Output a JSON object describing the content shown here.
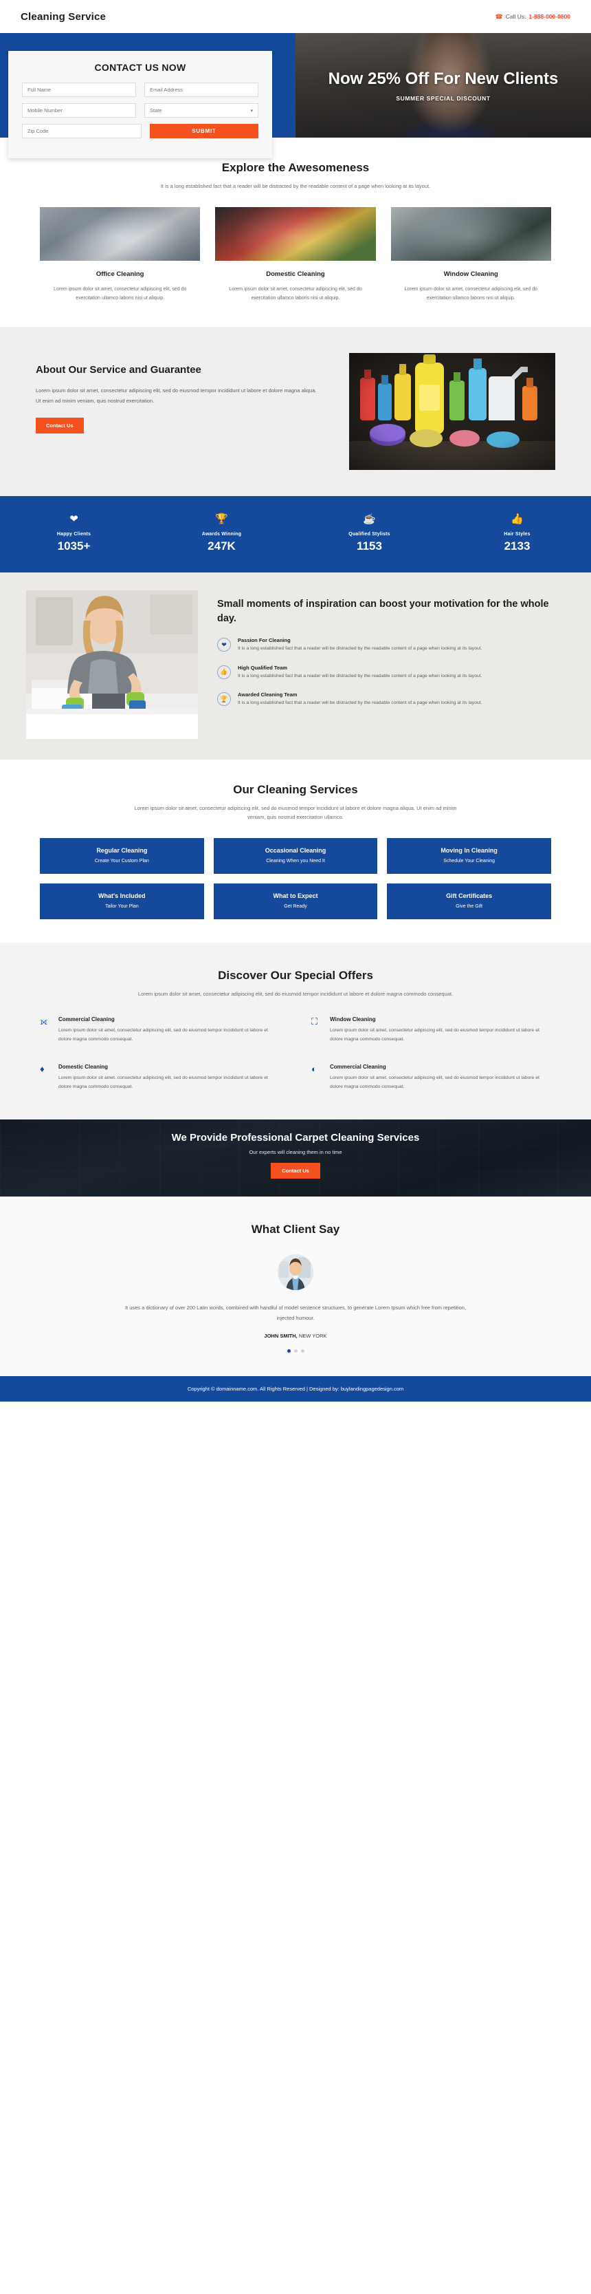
{
  "header": {
    "brand": "Cleaning Service",
    "call_label": "Call Us:",
    "phone": "1-888-000-0800",
    "phone_icon": "phone-icon"
  },
  "hero": {
    "headline": "Now 25% Off For New Clients",
    "subline": "SUMMER SPECIAL DISCOUNT"
  },
  "contact_form": {
    "title": "CONTACT US NOW",
    "full_name_placeholder": "Full Name",
    "email_placeholder": "Email Address",
    "mobile_placeholder": "Mobile Number",
    "state_placeholder": "State",
    "zip_placeholder": "Zip Code",
    "submit_label": "SUBMIT"
  },
  "explore": {
    "title": "Explore the Awesomeness",
    "desc": "It is a long established fact that a reader will be distracted by the readable content of a page when looking at its layout.",
    "cards": [
      {
        "title": "Office Cleaning",
        "text": "Lorem ipsum dolor sit amet, consectetur adipiscing elit, sed do exercitation ullamco laboris nisi ut aliquip."
      },
      {
        "title": "Domestic Cleaning",
        "text": "Lorem ipsum dolor sit amet, consectetur adipiscing elit, sed do exercitation ullamco laboris nisi ut aliquip."
      },
      {
        "title": "Window Cleaning",
        "text": "Lorem ipsum dolor sit amet, consectetur adipiscing elit, sed do exercitation ullamco laboris nisi ut aliquip."
      }
    ]
  },
  "about": {
    "title": "About Our Service and Guarantee",
    "text": "Lorem ipsum dolor sit amet, consectetur adipiscing elit, sed do eiusmod tempor incididunt ut labore et dolore magna aliqua. Ut enim ad minim veniam, quis nostrud exercitation.",
    "button": "Contact Us"
  },
  "stats": [
    {
      "icon": "heart-icon",
      "label": "Happy Clients",
      "value": "1035+"
    },
    {
      "icon": "trophy-icon",
      "label": "Awards Winning",
      "value": "247K"
    },
    {
      "icon": "coffee-cup-icon",
      "label": "Qualified Stylists",
      "value": "1153"
    },
    {
      "icon": "thumbs-up-icon",
      "label": "Hair Styles",
      "value": "2133"
    }
  ],
  "inspiration": {
    "title": "Small moments of inspiration can boost your motivation for the whole day.",
    "features": [
      {
        "icon": "heart-icon",
        "title": "Passion For Cleaning",
        "text": "It is a long established fact that a reader will be distracted by the readable content of a page when looking at its layout."
      },
      {
        "icon": "thumbs-up-icon",
        "title": "High Qualified Team",
        "text": "It is a long established fact that a reader will be distracted by the readable content of a page when looking at its layout."
      },
      {
        "icon": "trophy-icon",
        "title": "Awarded Cleaning Team",
        "text": "It is a long established fact that a reader will be distracted by the readable content of a page when looking at its layout."
      }
    ]
  },
  "services": {
    "title": "Our Cleaning Services",
    "desc": "Lorem ipsum dolor sit amet, consectetur adipiscing elit, sed do eiusmod tempor incididunt ut labore et dolore magna aliqua. Ut enim ad minim veniam, quis nostrud exercitation ullamco.",
    "tiles": [
      {
        "title": "Regular Cleaning",
        "sub": "Create Your Custom Plan"
      },
      {
        "title": "Occasional Cleaning",
        "sub": "Cleaning When you Need It"
      },
      {
        "title": "Moving In Cleaning",
        "sub": "Schedule Your Cleaning"
      },
      {
        "title": "What's Included",
        "sub": "Tailor Your Plan"
      },
      {
        "title": "What to Expect",
        "sub": "Get Ready"
      },
      {
        "title": "Gift Certificates",
        "sub": "Give the Gift"
      }
    ]
  },
  "offers": {
    "title": "Discover Our Special Offers",
    "desc": "Lorem ipsum dolor sit amet, consectetur adipiscing elit, sed do eiusmod tempor incididunt ut labore et dolore magna commodo consequat.",
    "items": [
      {
        "icon": "shuffle-icon",
        "title": "Commercial Cleaning",
        "text": "Lorem ipsum dolor sit amet, consectetur adipiscing elit, sed do eiusmod tempor incididunt ut labore et dolore magna commodo consequat."
      },
      {
        "icon": "window-icon",
        "title": "Window Cleaning",
        "text": "Lorem ipsum dolor sit amet, consectetur adipiscing elit, sed do eiusmod tempor incididunt ut labore et dolore magna commodo consequat."
      },
      {
        "icon": "diamond-icon",
        "title": "Domestic Cleaning",
        "text": "Lorem ipsum dolor sit amet, consectetur adipiscing elit, sed do eiusmod tempor incididunt ut labore et dolore magna commodo consequat."
      },
      {
        "icon": "pie-chart-icon",
        "title": "Commercial Cleaning",
        "text": "Lorem ipsum dolor sit amet, consectetur adipiscing elit, sed do eiusmod tempor incididunt ut labore et dolore magna commodo consequat."
      }
    ]
  },
  "cta": {
    "title": "We Provide Professional Carpet Cleaning Services",
    "sub": "Our experts will cleaning them in no time",
    "button": "Contact Us"
  },
  "testimonial": {
    "title": "What Client Say",
    "quote": "It uses a dictionary of over 200 Latin words, combined with handful of model sentence structures, to generate Lorem Ipsum which free from repetition, injected humour.",
    "author": "JOHN SMITH,",
    "location": "NEW YORK",
    "dots": [
      true,
      false,
      false
    ]
  },
  "footer": {
    "text": "Copyright © domainname.com. All Rights Reserved | Designed by: buylandingpagedesign.com"
  },
  "colors": {
    "brand_blue": "#14499c",
    "accent_orange": "#f4511e",
    "phone_red": "#f0462a"
  }
}
